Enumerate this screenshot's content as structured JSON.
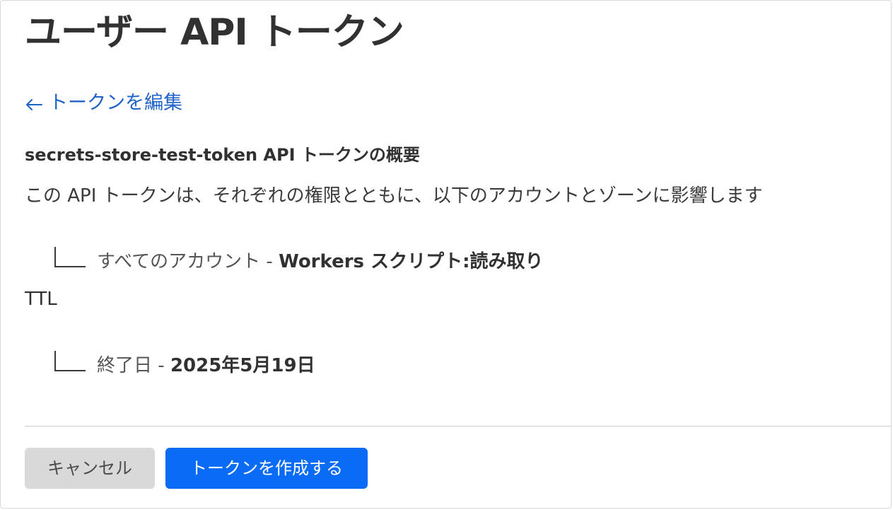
{
  "page": {
    "title": "ユーザー API トークン"
  },
  "nav": {
    "back_label": "トークンを編集"
  },
  "summary": {
    "title": "secrets-store-test-token API トークンの概要",
    "description": "この API トークンは、それぞれの権限とともに、以下のアカウントとゾーンに影響します",
    "permissions": [
      {
        "scope": "すべてのアカウント",
        "separator": " - ",
        "permission": "Workers スクリプト:読み取り"
      }
    ],
    "ttl": {
      "label": "TTL",
      "end_label": "終了日",
      "separator": " - ",
      "end_value": "2025年5月19日"
    }
  },
  "actions": {
    "cancel_label": "キャンセル",
    "create_label": "トークンを作成する"
  },
  "colors": {
    "link": "#1f63c9",
    "primary_button": "#0a6cf5",
    "secondary_button": "#d9d9d9",
    "text": "#313131"
  },
  "icons": {
    "back": "arrow-left-icon"
  }
}
